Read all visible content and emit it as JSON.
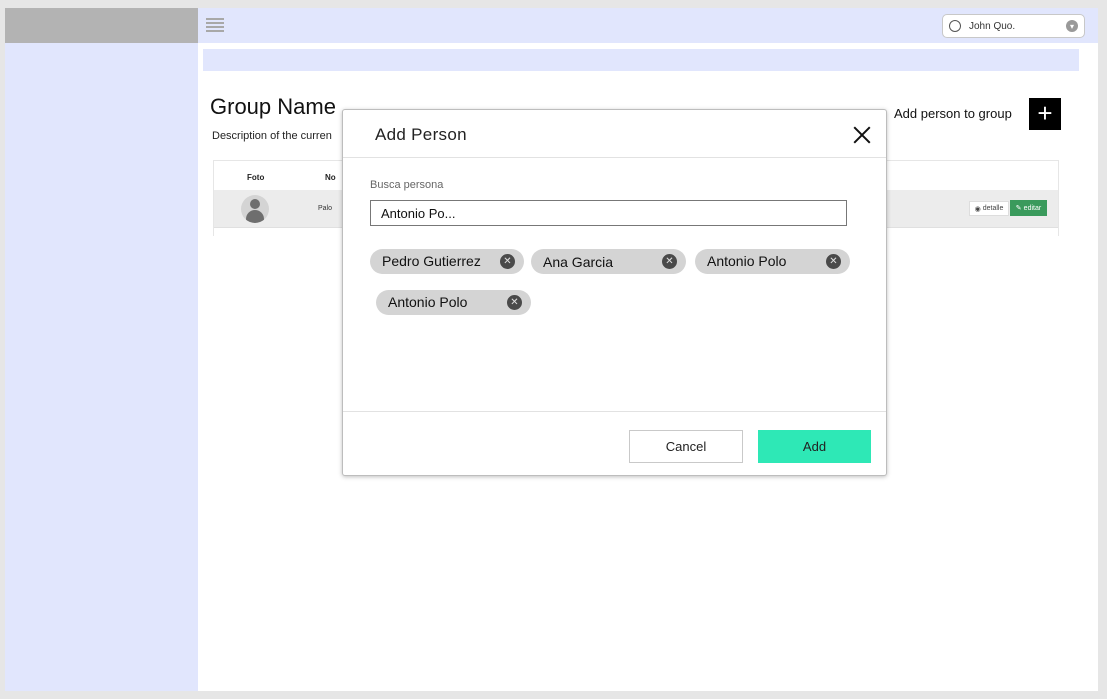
{
  "header": {
    "user_name": "John Quo."
  },
  "page": {
    "title": "Group Name",
    "description": "Description of the curren"
  },
  "actions": {
    "add_person_label": "Add person to group",
    "add_person_icon": "plus-icon"
  },
  "table": {
    "columns": [
      "Foto",
      "No"
    ],
    "rows": [
      {
        "name": "Palo",
        "detail_label": "detalle",
        "edit_label": "editar"
      }
    ]
  },
  "modal": {
    "title": "Add Person",
    "search_label": "Busca persona",
    "search_value": "Antonio Po...",
    "chips": [
      "Pedro Gutierrez",
      "Ana Garcia",
      "Antonio Polo",
      "Antonio Polo"
    ],
    "chip_remove_glyph": "✕",
    "cancel_label": "Cancel",
    "add_label": "Add"
  },
  "colors": {
    "sidebar": "#e1e6fd",
    "topbar": "#e1e6fd",
    "sidebar_header": "#b3b3b3",
    "add_button": "#2ee8b6",
    "edit_button": "#3a9a5c",
    "chip": "#d4d4d4"
  }
}
